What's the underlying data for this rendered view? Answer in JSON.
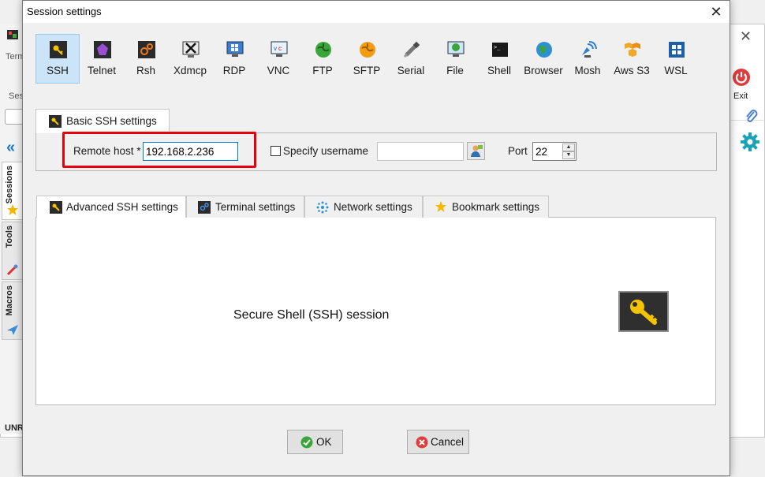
{
  "background_app": {
    "term_label": "Term",
    "session_label": "Sess",
    "unr_label": "UNR",
    "side_tabs": [
      "Sessions",
      "Tools",
      "Macros"
    ],
    "exit_label": "Exit"
  },
  "dialog": {
    "title": "Session settings",
    "protocols": [
      {
        "label": "SSH",
        "icon": "ssh-key-icon",
        "selected": true
      },
      {
        "label": "Telnet",
        "icon": "telnet-icon"
      },
      {
        "label": "Rsh",
        "icon": "rsh-icon"
      },
      {
        "label": "Xdmcp",
        "icon": "xdmcp-icon"
      },
      {
        "label": "RDP",
        "icon": "rdp-icon"
      },
      {
        "label": "VNC",
        "icon": "vnc-icon"
      },
      {
        "label": "FTP",
        "icon": "ftp-icon"
      },
      {
        "label": "SFTP",
        "icon": "sftp-icon"
      },
      {
        "label": "Serial",
        "icon": "serial-icon"
      },
      {
        "label": "File",
        "icon": "file-icon"
      },
      {
        "label": "Shell",
        "icon": "shell-icon"
      },
      {
        "label": "Browser",
        "icon": "browser-icon"
      },
      {
        "label": "Mosh",
        "icon": "mosh-icon"
      },
      {
        "label": "Aws S3",
        "icon": "aws-s3-icon"
      },
      {
        "label": "WSL",
        "icon": "wsl-icon"
      }
    ],
    "basic_tab_label": "Basic SSH settings",
    "remote_host_label": "Remote host *",
    "remote_host_value": "192.168.2.236",
    "specify_username_label": "Specify username",
    "username_value": "",
    "port_label": "Port",
    "port_value": "22",
    "lower_tabs": [
      {
        "label": "Advanced SSH settings",
        "icon": "key-icon"
      },
      {
        "label": "Terminal settings",
        "icon": "terminal-icon"
      },
      {
        "label": "Network settings",
        "icon": "network-icon"
      },
      {
        "label": "Bookmark settings",
        "icon": "star-icon"
      }
    ],
    "session_description": "Secure Shell (SSH) session",
    "ok_label": "OK",
    "cancel_label": "Cancel"
  },
  "colors": {
    "selected_protocol_bg": "#cce4f7",
    "highlight_border": "#e8000d",
    "input_focus_border": "#0078d7"
  }
}
